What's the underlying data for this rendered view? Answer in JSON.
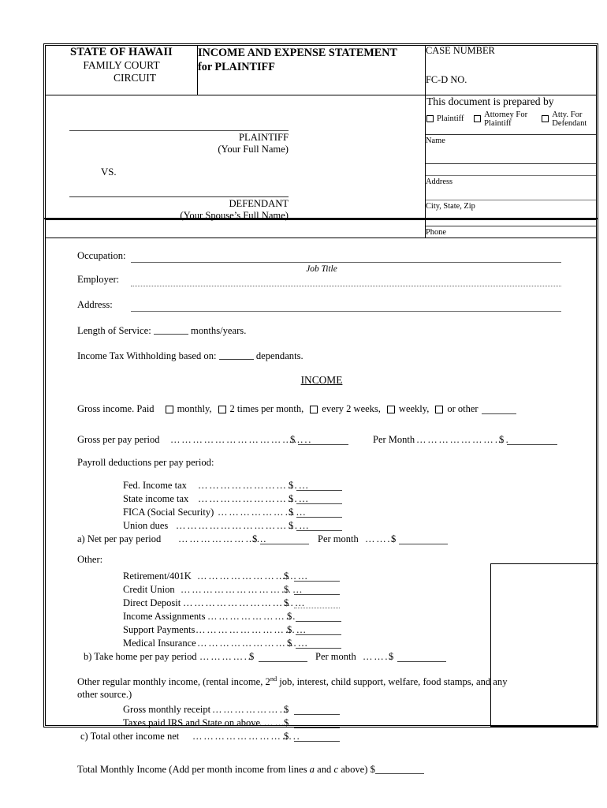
{
  "header": {
    "state_line1": "STATE OF HAWAII",
    "state_line2": "FAMILY COURT",
    "state_line3": "CIRCUIT",
    "title_line1": "INCOME AND EXPENSE STATEMENT",
    "title_line2": "for PLAINTIFF",
    "case_number_label": "CASE NUMBER",
    "fcd_no_label": "FC-D NO."
  },
  "caption": {
    "plaintiff_label": "PLAINTIFF",
    "plaintiff_sublabel": "(Your Full Name)",
    "vs_label": "VS.",
    "defendant_label": "DEFENDANT",
    "defendant_sublabel": "(Your Spouse’s Full Name)",
    "prepared_by_title": "This document is prepared by",
    "prepared_by_options": [
      "Plaintiff",
      "Attorney For Plaintiff",
      "Atty. For Defendant"
    ],
    "fields": [
      "Name",
      "Address",
      "City, State, Zip",
      "Phone"
    ]
  },
  "employment": {
    "occupation_label": "Occupation:",
    "job_title_caption": "Job Title",
    "employer_label": "Employer:",
    "address_label": "Address:",
    "length_of_service_prefix": "Length of Service:",
    "length_of_service_suffix": "months/years.",
    "withholding_prefix": "Income Tax Withholding based on:",
    "withholding_suffix": "dependants."
  },
  "income": {
    "section_title": "INCOME",
    "gross_income_prefix": "Gross income.  Paid",
    "frequency_options": [
      "monthly,",
      "2 times per month,",
      "every 2 weeks,",
      "weekly,",
      "or other"
    ],
    "gross_per_pay_label": "Gross per pay period",
    "per_month_label": "Per Month",
    "dollar_sign": "$",
    "payroll_deductions_title": "Payroll deductions per pay period:",
    "payroll_deductions": [
      "Fed. Income tax",
      "State income tax",
      "FICA (Social Security)",
      "Union dues"
    ],
    "line_a_label": "a) Net per pay period",
    "line_a_per_month": "Per month",
    "other_title": "Other:",
    "other_deductions": [
      "Retirement/401K",
      "Credit Union",
      "Direct Deposit",
      "Income Assignments",
      "Support Payments",
      "Medical Insurance"
    ],
    "line_b_label": "b)  Take home per pay period",
    "line_b_per_month": "Per month",
    "other_income_line1": "Other regular monthly income, (rental income, 2",
    "other_income_line1_sup": "nd",
    "other_income_line1_cont": " job, interest, child support, welfare, food stamps, and any",
    "other_income_line2": "other source.)",
    "other_income_items": [
      "Gross monthly receipt",
      "Taxes paid IRS and State on above"
    ],
    "line_c_label": "c)     Total other income net",
    "total_monthly_income_pre": "Total Monthly Income (Add per month income from lines ",
    "total_monthly_income_a": "a",
    "total_monthly_income_mid": " and ",
    "total_monthly_income_c": "c",
    "total_monthly_income_post": " above)"
  }
}
